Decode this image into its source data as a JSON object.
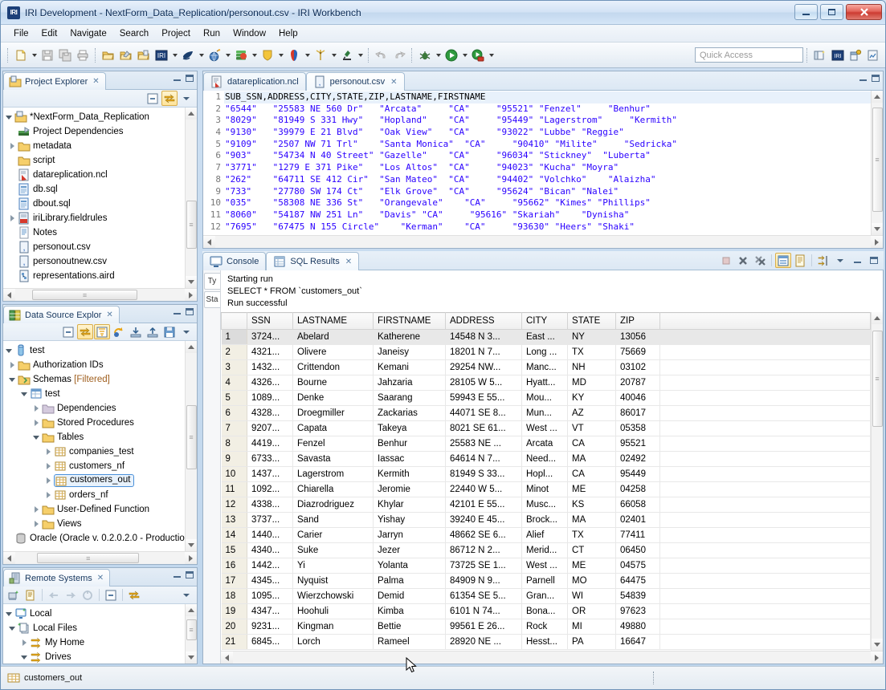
{
  "window": {
    "title": "IRI Development - NextForm_Data_Replication/personout.csv - IRI Workbench",
    "app_badge": "IRI",
    "minimize": "Minimize",
    "maximize": "Maximize",
    "close": "Close"
  },
  "menubar": {
    "items": [
      "File",
      "Edit",
      "Navigate",
      "Search",
      "Project",
      "Run",
      "Window",
      "Help"
    ]
  },
  "toolbar": {
    "quick_access_placeholder": "Quick Access",
    "buttons": [
      {
        "name": "new-wizard",
        "has_arrow": true
      },
      {
        "name": "save",
        "has_arrow": false
      },
      {
        "name": "save-all",
        "has_arrow": false
      },
      {
        "name": "print",
        "has_arrow": false
      },
      {
        "name": "open-folder-1",
        "has_arrow": false
      },
      {
        "name": "open-folder-2",
        "has_arrow": false
      },
      {
        "name": "open-folder-3",
        "has_arrow": false
      },
      {
        "name": "iri-job",
        "has_arrow": true
      },
      {
        "name": "sortcl-whale",
        "has_arrow": true
      },
      {
        "name": "globe-bomb",
        "has_arrow": true
      },
      {
        "name": "data-stack",
        "has_arrow": true
      },
      {
        "name": "shield",
        "has_arrow": true
      },
      {
        "name": "mask-figure",
        "has_arrow": true
      },
      {
        "name": "wind-turbine",
        "has_arrow": true
      },
      {
        "name": "microscope",
        "has_arrow": true
      },
      {
        "name": "undo",
        "has_arrow": false
      },
      {
        "name": "redo",
        "has_arrow": false
      },
      {
        "name": "debug",
        "has_arrow": true
      },
      {
        "name": "run",
        "has_arrow": true
      },
      {
        "name": "run-external",
        "has_arrow": true
      }
    ],
    "right_buttons": [
      {
        "name": "open-perspective"
      },
      {
        "name": "iri-perspective"
      },
      {
        "name": "data-perspective"
      },
      {
        "name": "report-perspective"
      }
    ]
  },
  "project_explorer": {
    "tab_label": "Project Explorer",
    "close": "✕",
    "toolbar": [
      "collapse-all",
      "link-with-editor",
      "view-menu"
    ],
    "tree": [
      {
        "indent": 0,
        "twist": "open",
        "icon": "project-folder",
        "label": "*NextForm_Data_Replication"
      },
      {
        "indent": 1,
        "twist": "none",
        "icon": "dependencies",
        "label": "Project Dependencies"
      },
      {
        "indent": 1,
        "twist": "closed",
        "icon": "folder",
        "label": "metadata"
      },
      {
        "indent": 1,
        "twist": "none",
        "icon": "folder",
        "label": "script"
      },
      {
        "indent": 1,
        "twist": "none",
        "icon": "ncl-file",
        "label": "datareplication.ncl"
      },
      {
        "indent": 1,
        "twist": "none",
        "icon": "sql-file",
        "label": "db.sql"
      },
      {
        "indent": 1,
        "twist": "none",
        "icon": "sql-file",
        "label": "dbout.sql"
      },
      {
        "indent": 1,
        "twist": "closed",
        "icon": "fieldrules-file",
        "label": "iriLibrary.fieldrules"
      },
      {
        "indent": 1,
        "twist": "none",
        "icon": "text-file",
        "label": "Notes"
      },
      {
        "indent": 1,
        "twist": "none",
        "icon": "csv-file",
        "label": "personout.csv"
      },
      {
        "indent": 1,
        "twist": "none",
        "icon": "csv-file",
        "label": "personoutnew.csv"
      },
      {
        "indent": 1,
        "twist": "none",
        "icon": "aird-file",
        "label": "representations.aird"
      }
    ]
  },
  "data_source_explorer": {
    "tab_label": "Data Source Explor",
    "close": "✕",
    "toolbar": [
      "collapse-all",
      "link-with-editor",
      "filter",
      "refresh",
      "import",
      "export",
      "save"
    ],
    "tree": [
      {
        "indent": 0,
        "twist": "open",
        "icon": "connection",
        "label": "test",
        "suffix": ""
      },
      {
        "indent": 1,
        "twist": "closed",
        "icon": "folder",
        "label": "Authorization IDs",
        "suffix": ""
      },
      {
        "indent": 1,
        "twist": "open",
        "icon": "schemas",
        "label": "Schemas ",
        "suffix": "[Filtered]"
      },
      {
        "indent": 2,
        "twist": "open",
        "icon": "schema",
        "label": "test",
        "suffix": ""
      },
      {
        "indent": 3,
        "twist": "closed",
        "icon": "folder-gray",
        "label": "Dependencies",
        "suffix": ""
      },
      {
        "indent": 3,
        "twist": "closed",
        "icon": "folder",
        "label": "Stored Procedures",
        "suffix": ""
      },
      {
        "indent": 3,
        "twist": "open",
        "icon": "folder",
        "label": "Tables",
        "suffix": ""
      },
      {
        "indent": 4,
        "twist": "closed",
        "icon": "table",
        "label": "companies_test",
        "suffix": ""
      },
      {
        "indent": 4,
        "twist": "closed",
        "icon": "table",
        "label": "customers_nf",
        "suffix": ""
      },
      {
        "indent": 4,
        "twist": "closed",
        "icon": "table",
        "label": "customers_out",
        "suffix": "",
        "selected": true
      },
      {
        "indent": 4,
        "twist": "closed",
        "icon": "table",
        "label": "orders_nf",
        "suffix": ""
      },
      {
        "indent": 3,
        "twist": "closed",
        "icon": "folder",
        "label": "User-Defined Function",
        "suffix": ""
      },
      {
        "indent": 3,
        "twist": "closed",
        "icon": "folder",
        "label": "Views",
        "suffix": ""
      },
      {
        "indent": 0,
        "twist": "none",
        "icon": "db-gray",
        "label": "Oracle (Oracle v. 0.2.0.2.0 - Productio",
        "suffix": ""
      }
    ]
  },
  "remote_systems": {
    "tab_label": "Remote Systems",
    "close": "✕",
    "toolbar": [
      "new-connection",
      "properties",
      "back",
      "forward",
      "refresh",
      "collapse-all",
      "link-with-editor",
      "view-menu"
    ],
    "tree": [
      {
        "indent": 0,
        "twist": "open",
        "icon": "local-system",
        "label": "Local"
      },
      {
        "indent": 1,
        "twist": "open",
        "icon": "local-files",
        "label": "Local Files"
      },
      {
        "indent": 2,
        "twist": "closed",
        "icon": "filter-arrow",
        "label": "My Home"
      },
      {
        "indent": 2,
        "twist": "open",
        "icon": "filter-arrow",
        "label": "Drives"
      }
    ]
  },
  "editor": {
    "tabs": [
      {
        "label": "datareplication.ncl",
        "icon": "ncl-file",
        "active": false,
        "closeable": false
      },
      {
        "label": "personout.csv",
        "icon": "csv-file",
        "active": true,
        "closeable": true,
        "close": "✕"
      }
    ],
    "line_numbers": [
      "1",
      "2",
      "3",
      "4",
      "5",
      "6",
      "7",
      "8",
      "9",
      "10",
      "11",
      "12"
    ],
    "lines": [
      "SUB_SSN,ADDRESS,CITY,STATE,ZIP,LASTNAME,FIRSTNAME",
      "\"6544\"   \"25583 NE 560 Dr\"   \"Arcata\"     \"CA\"     \"95521\" \"Fenzel\"     \"Benhur\"",
      "\"8029\"   \"81949 S 331 Hwy\"   \"Hopland\"    \"CA\"     \"95449\" \"Lagerstrom\"     \"Kermith\"",
      "\"9130\"   \"39979 E 21 Blvd\"   \"Oak View\"   \"CA\"     \"93022\" \"Lubbe\" \"Reggie\"",
      "\"9109\"   \"2507 NW 71 Trl\"    \"Santa Monica\"  \"CA\"     \"90410\" \"Milite\"     \"Sedricka\"",
      "\"903\"    \"54734 N 40 Street\" \"Gazelle\"    \"CA\"     \"96034\" \"Stickney\"  \"Luberta\"",
      "\"3771\"   \"1279 E 371 Pike\"   \"Los Altos\"  \"CA\"     \"94023\" \"Kucha\" \"Moyra\"",
      "\"262\"    \"64711 SE 412 Cir\"  \"San Mateo\"  \"CA\"     \"94402\" \"Volchko\"    \"Alaizha\"",
      "\"733\"    \"27780 SW 174 Ct\"   \"Elk Grove\"  \"CA\"     \"95624\" \"Bican\" \"Nalei\"",
      "\"035\"    \"58308 NE 336 St\"   \"Orangevale\"    \"CA\"     \"95662\" \"Kimes\" \"Phillips\"",
      "\"8060\"   \"54187 NW 251 Ln\"   \"Davis\" \"CA\"     \"95616\" \"Skariah\"    \"Dynisha\"",
      "\"7695\"   \"67475 N 155 Circle\"    \"Kerman\"    \"CA\"     \"93630\" \"Heers\" \"Shaki\""
    ]
  },
  "results": {
    "tabs": [
      {
        "label": "Console",
        "icon": "console-icon",
        "active": false
      },
      {
        "label": "SQL Results",
        "icon": "sql-results-icon",
        "active": true,
        "close": "✕"
      }
    ],
    "toolbar": [
      "terminate",
      "remove-launch",
      "remove-all-launches",
      "show-status-pane",
      "show-detail-pane",
      "pin-results",
      "view-menu",
      "minimize",
      "maximize"
    ],
    "side_tabs": [
      "Ty",
      "Sta"
    ],
    "status_lines": [
      "Starting run",
      "SELECT * FROM `customers_out`",
      "Run successful"
    ],
    "columns": [
      "",
      "SSN",
      "LASTNAME",
      "FIRSTNAME",
      "ADDRESS",
      "CITY",
      "STATE",
      "ZIP",
      ""
    ],
    "rows": [
      [
        "1",
        "3724...",
        "Abelard",
        "Katherene",
        "14548 N 3...",
        "East ...",
        "NY",
        "13056"
      ],
      [
        "2",
        "4321...",
        "Olivere",
        "Janeisy",
        "18201 N 7...",
        "Long ...",
        "TX",
        "75669"
      ],
      [
        "3",
        "1432...",
        "Crittendon",
        "Kemani",
        "29254 NW...",
        "Manc...",
        "NH",
        "03102"
      ],
      [
        "4",
        "4326...",
        "Bourne",
        "Jahzaria",
        "28105 W 5...",
        "Hyatt...",
        "MD",
        "20787"
      ],
      [
        "5",
        "1089...",
        "Denke",
        "Saarang",
        "59943 E 55...",
        "Mou...",
        "KY",
        "40046"
      ],
      [
        "6",
        "4328...",
        "Droegmiller",
        "Zackarias",
        "44071 SE 8...",
        "Mun...",
        "AZ",
        "86017"
      ],
      [
        "7",
        "9207...",
        "Capata",
        "Takeya",
        "8021 SE 61...",
        "West ...",
        "VT",
        "05358"
      ],
      [
        "8",
        "4419...",
        "Fenzel",
        "Benhur",
        "25583 NE ...",
        "Arcata",
        "CA",
        "95521"
      ],
      [
        "9",
        "6733...",
        "Savasta",
        "Iassac",
        "64614 N 7...",
        "Need...",
        "MA",
        "02492"
      ],
      [
        "10",
        "1437...",
        "Lagerstrom",
        "Kermith",
        "81949 S 33...",
        "Hopl...",
        "CA",
        "95449"
      ],
      [
        "11",
        "1092...",
        "Chiarella",
        "Jeromie",
        "22440 W 5...",
        "Minot",
        "ME",
        "04258"
      ],
      [
        "12",
        "4338...",
        "Diazrodriguez",
        "Khylar",
        "42101 E 55...",
        "Musc...",
        "KS",
        "66058"
      ],
      [
        "13",
        "3737...",
        "Sand",
        "Yishay",
        "39240 E 45...",
        "Brock...",
        "MA",
        "02401"
      ],
      [
        "14",
        "1440...",
        "Carier",
        "Jarryn",
        "48662 SE 6...",
        "Alief",
        "TX",
        "77411"
      ],
      [
        "15",
        "4340...",
        "Suke",
        "Jezer",
        "86712 N 2...",
        "Merid...",
        "CT",
        "06450"
      ],
      [
        "16",
        "1442...",
        "Yi",
        "Yolanta",
        "73725 SE 1...",
        "West ...",
        "ME",
        "04575"
      ],
      [
        "17",
        "4345...",
        "Nyquist",
        "Palma",
        "84909 N 9...",
        "Parnell",
        "MO",
        "64475"
      ],
      [
        "18",
        "1095...",
        "Wierzchowski",
        "Demid",
        "61354 SE 5...",
        "Gran...",
        "WI",
        "54839"
      ],
      [
        "19",
        "4347...",
        "Hoohuli",
        "Kimba",
        "6101 N 74...",
        "Bona...",
        "OR",
        "97623"
      ],
      [
        "20",
        "9231...",
        "Kingman",
        "Bettie",
        "99561 E 26...",
        "Rock",
        "MI",
        "49880"
      ],
      [
        "21",
        "6845...",
        "Lorch",
        "Rameel",
        "28920 NE ...",
        "Hesst...",
        "PA",
        "16647"
      ]
    ],
    "selected_row_index": 0
  },
  "statusbar": {
    "item_label": "customers_out",
    "item_icon": "table-icon"
  },
  "colors": {
    "accent": "#ffd24d",
    "titlebar_text": "#0a2a55",
    "selection": "#e8f1fb",
    "string_literal": "#2a00ff",
    "rownum_bg": "#f2efe4"
  }
}
